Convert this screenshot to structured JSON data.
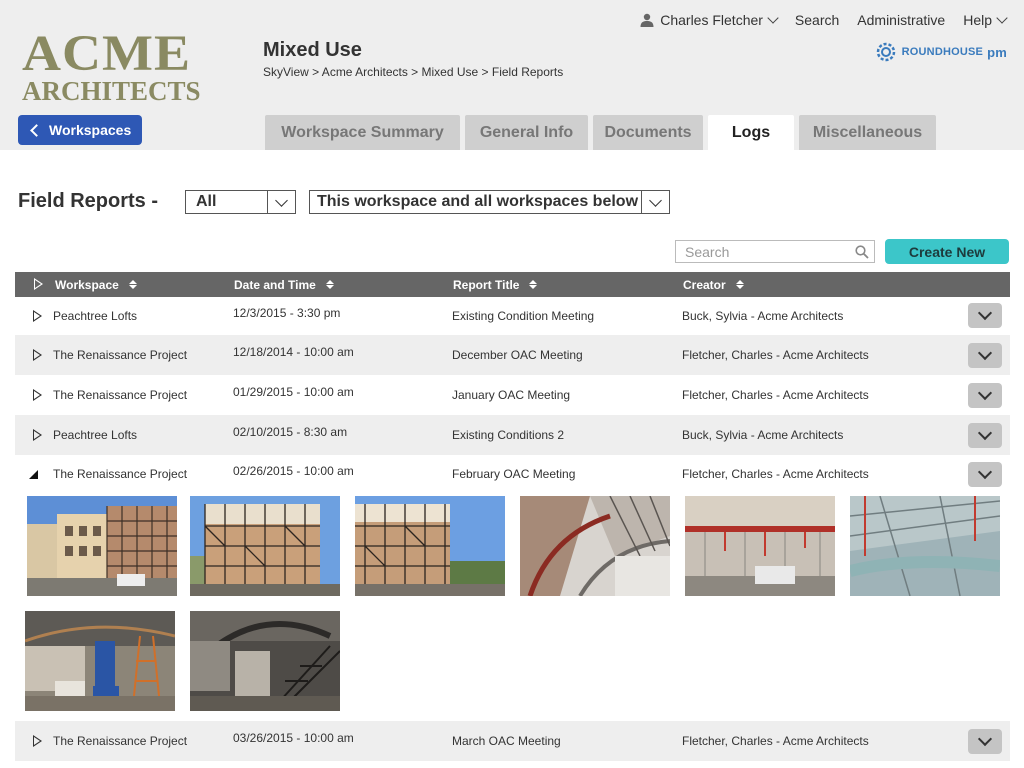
{
  "header": {
    "logo_line1": "ACME",
    "logo_line2": "ARCHITECTS",
    "workspace_title": "Mixed Use",
    "breadcrumb": "SkyView > Acme Architects > Mixed Use > Field Reports",
    "brand_main": "ROUNDHOUSE",
    "brand_suffix": "pm",
    "back_label": "Workspaces"
  },
  "topnav": {
    "user": "Charles Fletcher",
    "search": "Search",
    "administrative": "Administrative",
    "help": "Help"
  },
  "tabs": [
    {
      "label": "Workspace Summary",
      "active": false
    },
    {
      "label": "General Info",
      "active": false
    },
    {
      "label": "Documents",
      "active": false
    },
    {
      "label": "Logs",
      "active": true
    },
    {
      "label": "Miscellaneous",
      "active": false
    }
  ],
  "filters": {
    "title": "Field Reports -",
    "type_value": "All",
    "scope_value": "This workspace and all workspaces below"
  },
  "search": {
    "placeholder": "Search"
  },
  "create_label": "Create New",
  "columns": [
    "Workspace",
    "Date and Time",
    "Report Title",
    "Creator"
  ],
  "rows": [
    {
      "workspace": "Peachtree Lofts",
      "datetime": "12/3/2015 - 3:30 pm",
      "title": "Existing Condition Meeting",
      "creator": "Buck, Sylvia - Acme Architects",
      "expanded": false
    },
    {
      "workspace": "The Renaissance Project",
      "datetime": "12/18/2014 - 10:00 am",
      "title": "December OAC Meeting",
      "creator": "Fletcher, Charles - Acme Architects",
      "expanded": false
    },
    {
      "workspace": "The Renaissance Project",
      "datetime": "01/29/2015 - 10:00 am",
      "title": "January OAC Meeting",
      "creator": "Fletcher, Charles - Acme Architects",
      "expanded": false
    },
    {
      "workspace": "Peachtree Lofts",
      "datetime": "02/10/2015 - 8:30 am",
      "title": "Existing Conditions 2",
      "creator": "Buck, Sylvia - Acme Architects",
      "expanded": false
    },
    {
      "workspace": "The Renaissance Project",
      "datetime": "02/26/2015 - 10:00 am",
      "title": "February OAC Meeting",
      "creator": "Fletcher, Charles - Acme Architects",
      "expanded": true
    },
    {
      "workspace": "The Renaissance Project",
      "datetime": "03/26/2015 - 10:00 am",
      "title": "March OAC Meeting",
      "creator": "Fletcher, Charles - Acme Architects",
      "expanded": false
    }
  ],
  "colors": {
    "header_bg": "#eeeeee",
    "back_button": "#2e58b5",
    "create_button": "#3cc6c9",
    "table_header": "#666666",
    "logo": "#8a8a62"
  }
}
